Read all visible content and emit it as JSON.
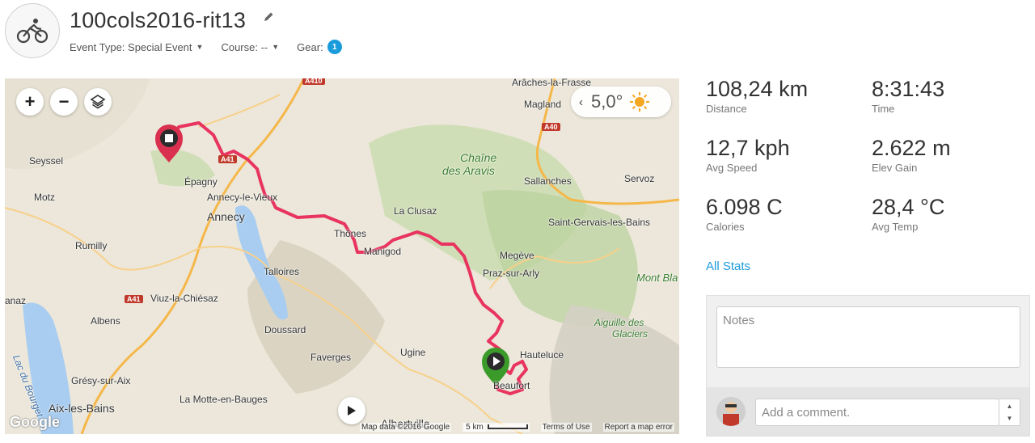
{
  "activity": {
    "title": "100cols2016-rit13",
    "icon": "cyclist-icon",
    "event_type_label": "Event Type: Special Event",
    "course_label": "Course: --",
    "gear_label": "Gear:",
    "gear_count": "1"
  },
  "map": {
    "zoom_in": "+",
    "zoom_out": "−",
    "weather_temp": "5,0°",
    "attribution": "Map data ©2016 Google",
    "scale": "5 km",
    "terms": "Terms of Use",
    "report": "Report a map error",
    "google_logo": "Google",
    "places": {
      "arches": "Arâches-la-Frasse",
      "magland": "Magland",
      "chaine_l1": "Chaîne",
      "chaine_l2": "des Aravis",
      "seyssel": "Seyssel",
      "epagny": "Épagny",
      "annecy_le_vieux": "Annecy-le-Vieux",
      "annecy": "Annecy",
      "motz": "Motz",
      "sallanches": "Sallanches",
      "servoz": "Servoz",
      "la_clusaz": "La Clusaz",
      "saint_gervais": "Saint-Gervais-les-Bains",
      "thones": "Thônes",
      "manigod": "Manigod",
      "rumilly": "Rumilly",
      "talloires": "Talloires",
      "megeve": "Megève",
      "praz": "Praz-sur-Arly",
      "mont_blanc": "Mont Bla",
      "anaz": "anaz",
      "viuz": "Viuz-la-Chiésaz",
      "albens": "Albens",
      "doussard": "Doussard",
      "aiguille_l1": "Aiguille des",
      "aiguille_l2": "Glaciers",
      "lac_bourget": "Lac du Bourget",
      "faverges": "Faverges",
      "ugine": "Ugine",
      "hauteluce": "Hauteluce",
      "gresy": "Grésy-sur-Aix",
      "beaufort": "Beaufort",
      "aix": "Aix-les-Bains",
      "la_motte": "La Motte-en-Bauges",
      "albertville": "Albertville"
    },
    "roads": {
      "a410": "A410",
      "a40": "A40",
      "a41_n": "A41",
      "a41_s": "A41"
    },
    "colors": {
      "route": "#e8345f",
      "start_marker": "#3b9b2a",
      "end_marker": "#d9304f"
    }
  },
  "stats": [
    {
      "value": "108,24 km",
      "label": "Distance"
    },
    {
      "value": "8:31:43",
      "label": "Time"
    },
    {
      "value": "12,7 kph",
      "label": "Avg Speed"
    },
    {
      "value": "2.622 m",
      "label": "Elev Gain"
    },
    {
      "value": "6.098 C",
      "label": "Calories"
    },
    {
      "value": "28,4 °C",
      "label": "Avg Temp"
    }
  ],
  "all_stats_link": "All Stats",
  "notes": {
    "placeholder": "Notes",
    "comment_placeholder": "Add a comment."
  }
}
